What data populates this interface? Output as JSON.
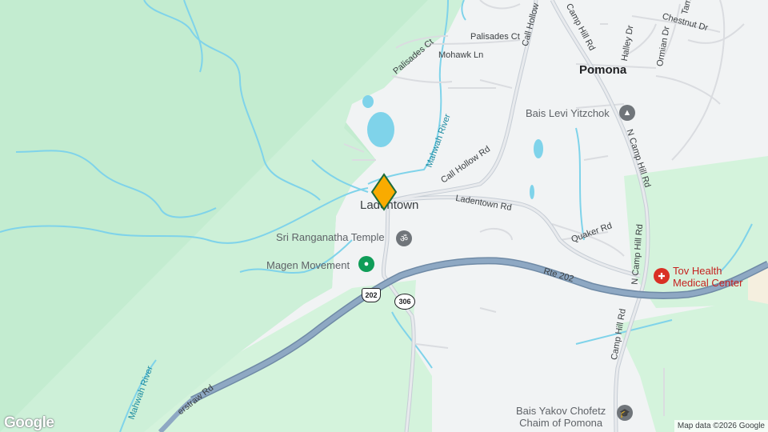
{
  "map": {
    "place_name": "Ladentown",
    "town_name": "Pomona",
    "pois": {
      "temple": "Sri Ranganatha Temple",
      "magen": "Magen Movement",
      "bais_levi": "Bais Levi Yitzchok",
      "tov_health_line1": "Tov Health",
      "tov_health_line2": "Medical Center",
      "bais_yakov_line1": "Bais Yakov Chofetz",
      "bais_yakov_line2": "Chaim of Pomona"
    },
    "roads": {
      "call_hollow_rd": "Call Hollow Rd",
      "call_hollow_top": "Call Hollow",
      "ladentown_rd": "Ladentown Rd",
      "camp_hill_rd": "Camp Hill Rd",
      "n_camp_hill_rd_upper": "N Camp Hill Rd",
      "n_camp_hill_rd_lower": "N Camp Hill Rd",
      "camp_hill_rd_lower": "Camp Hill Rd",
      "rte_202": "Rte 202",
      "haverstraw_rd": "erstraw Rd",
      "quaker_rd": "Quaker Rd",
      "palisades_ct": "Palisades Ct",
      "palisades_ct_2": "Palisades Ct",
      "mohawk_ln": "Mohawk Ln",
      "halley_dr": "Halley Dr",
      "ormian_dr": "Ormian Dr",
      "chestnut_dr": "Chestnut Dr",
      "tamarack": "Tam"
    },
    "water": {
      "mahwah_upper": "Mahwah River",
      "mahwah_lower": "Mahwah River"
    },
    "shields": {
      "us_202": "202",
      "state_306": "306"
    },
    "branding": {
      "logo": "Google",
      "attribution": "Map data ©2026 Google"
    },
    "icons": {
      "temple": "om-icon",
      "magen": "place-icon",
      "bais_levi": "worship-icon",
      "tov_health": "hospital-icon",
      "bais_yakov": "school-icon",
      "pin": "location-pin-icon"
    },
    "colors": {
      "forest": "#c8eed3",
      "forest_light": "#d7f2dd",
      "urban": "#f1f3f4",
      "water": "#7fd3ea",
      "highway": "#8aa0b8",
      "pin": "#f9ab00",
      "hospital": "#d93025",
      "poi_grey": "#70757a",
      "poi_green": "#0f9d58"
    }
  }
}
